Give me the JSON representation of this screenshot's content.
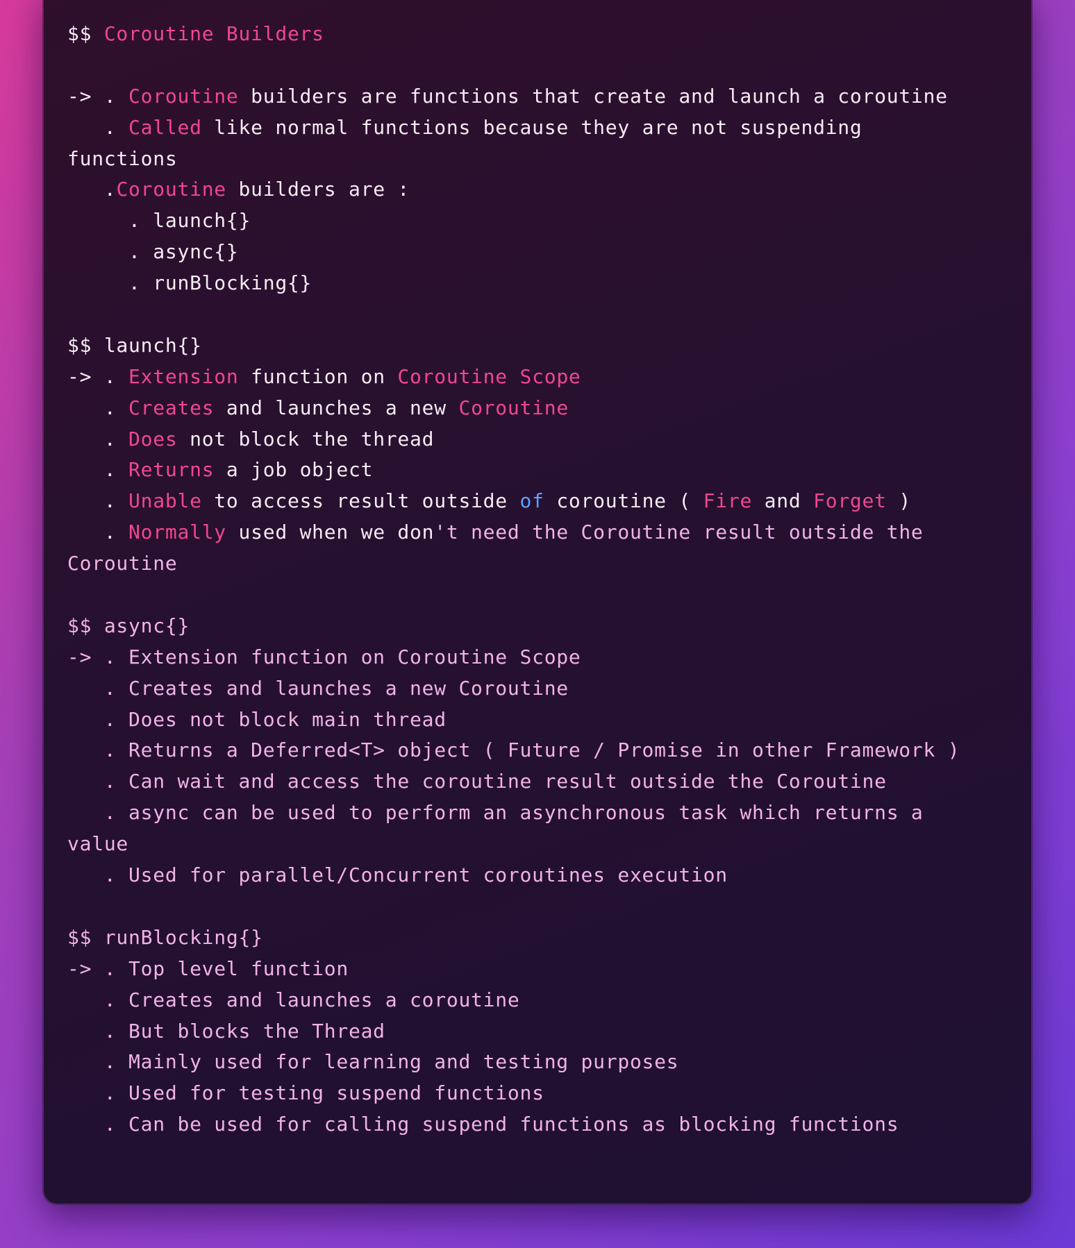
{
  "editor": {
    "lines": [
      {
        "id": "h1",
        "parts": [
          {
            "t": "$$ ",
            "c": "w"
          },
          {
            "t": "Coroutine Builders",
            "c": "p"
          }
        ]
      },
      {
        "id": "b1",
        "parts": []
      },
      {
        "id": "l1",
        "parts": [
          {
            "t": "-> . ",
            "c": "w"
          },
          {
            "t": "Coroutine",
            "c": "p"
          },
          {
            "t": " builders are functions that create and launch a coroutine",
            "c": "w"
          }
        ]
      },
      {
        "id": "l2",
        "parts": [
          {
            "t": "   . ",
            "c": "w"
          },
          {
            "t": "Called",
            "c": "p"
          },
          {
            "t": " like normal functions because they are not suspending",
            "c": "w"
          }
        ]
      },
      {
        "id": "l3",
        "parts": [
          {
            "t": "functions",
            "c": "w"
          }
        ]
      },
      {
        "id": "l4",
        "parts": [
          {
            "t": "   .",
            "c": "w"
          },
          {
            "t": "Coroutine",
            "c": "p"
          },
          {
            "t": " builders are :",
            "c": "w"
          }
        ]
      },
      {
        "id": "l5",
        "parts": [
          {
            "t": "     . launch{}",
            "c": "w"
          }
        ]
      },
      {
        "id": "l6",
        "parts": [
          {
            "t": "     . async{}",
            "c": "w"
          }
        ]
      },
      {
        "id": "l7",
        "parts": [
          {
            "t": "     . runBlocking{}",
            "c": "w"
          }
        ]
      },
      {
        "id": "b2",
        "parts": []
      },
      {
        "id": "h2",
        "parts": [
          {
            "t": "$$ launch{}",
            "c": "w"
          }
        ]
      },
      {
        "id": "l8",
        "parts": [
          {
            "t": "-> . ",
            "c": "w"
          },
          {
            "t": "Extension",
            "c": "p"
          },
          {
            "t": " function on ",
            "c": "w"
          },
          {
            "t": "Coroutine Scope",
            "c": "p"
          }
        ]
      },
      {
        "id": "l9",
        "parts": [
          {
            "t": "   . ",
            "c": "w"
          },
          {
            "t": "Creates",
            "c": "p"
          },
          {
            "t": " and launches a new ",
            "c": "w"
          },
          {
            "t": "Coroutine",
            "c": "p"
          }
        ]
      },
      {
        "id": "l10",
        "parts": [
          {
            "t": "   . ",
            "c": "w"
          },
          {
            "t": "Does",
            "c": "p"
          },
          {
            "t": " not block the thread",
            "c": "w"
          }
        ]
      },
      {
        "id": "l11",
        "parts": [
          {
            "t": "   . ",
            "c": "w"
          },
          {
            "t": "Returns",
            "c": "p"
          },
          {
            "t": " a job object",
            "c": "w"
          }
        ]
      },
      {
        "id": "l12",
        "parts": [
          {
            "t": "   . ",
            "c": "w"
          },
          {
            "t": "Unable",
            "c": "p"
          },
          {
            "t": " to access result outside ",
            "c": "w"
          },
          {
            "t": "of",
            "c": "b"
          },
          {
            "t": " coroutine ( ",
            "c": "w"
          },
          {
            "t": "Fire",
            "c": "p"
          },
          {
            "t": " and ",
            "c": "w"
          },
          {
            "t": "Forget",
            "c": "p"
          },
          {
            "t": " )",
            "c": "w"
          }
        ]
      },
      {
        "id": "l13",
        "parts": [
          {
            "t": "   . ",
            "c": "w"
          },
          {
            "t": "Normally",
            "c": "p"
          },
          {
            "t": " used when we don",
            "c": "w"
          },
          {
            "t": "'t need the Coroutine result outside the",
            "c": "l"
          }
        ]
      },
      {
        "id": "l14",
        "parts": [
          {
            "t": "Coroutine",
            "c": "l"
          }
        ]
      },
      {
        "id": "b3",
        "parts": []
      },
      {
        "id": "h3",
        "parts": [
          {
            "t": "$$ async{}",
            "c": "l"
          }
        ]
      },
      {
        "id": "l15",
        "parts": [
          {
            "t": "-> . Extension function on Coroutine Scope",
            "c": "l"
          }
        ]
      },
      {
        "id": "l16",
        "parts": [
          {
            "t": "   . Creates and launches a new Coroutine",
            "c": "l"
          }
        ]
      },
      {
        "id": "l17",
        "parts": [
          {
            "t": "   . Does not block main thread",
            "c": "l"
          }
        ]
      },
      {
        "id": "l18",
        "parts": [
          {
            "t": "   . Returns a Deferred<T> object ( Future / Promise in other Framework )",
            "c": "l"
          }
        ]
      },
      {
        "id": "l19",
        "parts": [
          {
            "t": "   . Can wait and access the coroutine result outside the Coroutine",
            "c": "l"
          }
        ]
      },
      {
        "id": "l20",
        "parts": [
          {
            "t": "   . async can be used to perform an asynchronous task which returns a",
            "c": "l"
          }
        ]
      },
      {
        "id": "l21",
        "parts": [
          {
            "t": "value",
            "c": "l"
          }
        ]
      },
      {
        "id": "l22",
        "parts": [
          {
            "t": "   . Used for parallel/Concurrent coroutines execution",
            "c": "l"
          }
        ]
      },
      {
        "id": "b4",
        "parts": []
      },
      {
        "id": "h4",
        "parts": [
          {
            "t": "$$ runBlocking{}",
            "c": "l"
          }
        ]
      },
      {
        "id": "l23",
        "parts": [
          {
            "t": "-> . Top level function",
            "c": "l"
          }
        ]
      },
      {
        "id": "l24",
        "parts": [
          {
            "t": "   . Creates and launches a coroutine",
            "c": "l"
          }
        ]
      },
      {
        "id": "l25",
        "parts": [
          {
            "t": "   . But blocks the Thread",
            "c": "l"
          }
        ]
      },
      {
        "id": "l26",
        "parts": [
          {
            "t": "   . Mainly used for learning and testing purposes",
            "c": "l"
          }
        ]
      },
      {
        "id": "l27",
        "parts": [
          {
            "t": "   . Used for testing suspend functions",
            "c": "l"
          }
        ]
      },
      {
        "id": "l28",
        "parts": [
          {
            "t": "   . Can be used for calling suspend functions as blocking functions",
            "c": "l"
          }
        ]
      }
    ]
  },
  "colors": {
    "background_gradient": [
      "#d63a9a",
      "#a23fb8",
      "#8d3fcf",
      "#6b3ad6"
    ],
    "window_bg": "#261030",
    "text_white": "#f6ecf3",
    "keyword_pink": "#f0478f",
    "keyword_blue": "#5ea0ff",
    "text_lavender": "#f1b3e6"
  }
}
